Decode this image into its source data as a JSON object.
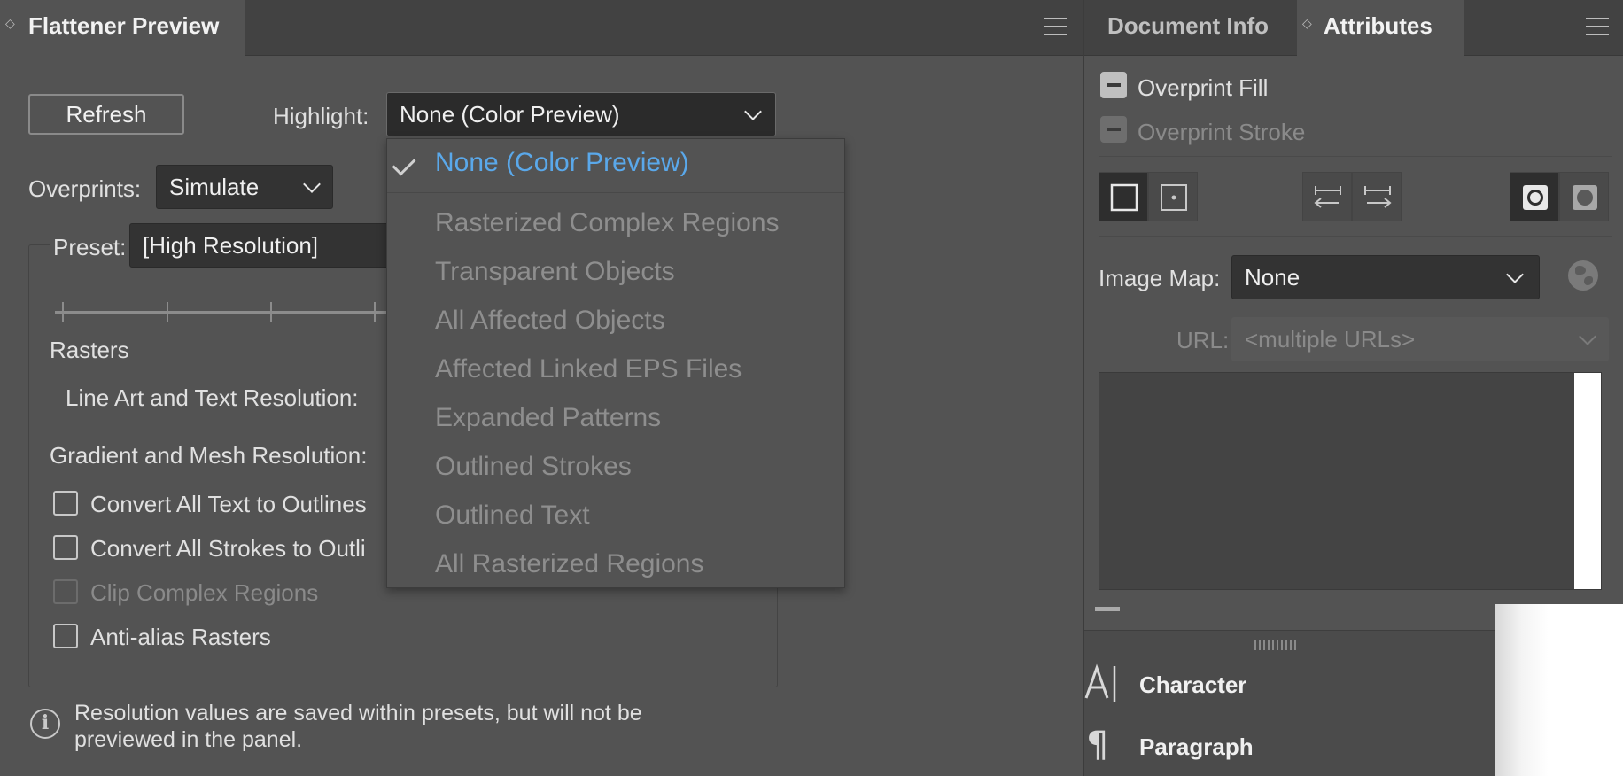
{
  "flattener": {
    "tab_title": "Flattener Preview",
    "refresh_label": "Refresh",
    "highlight_label": "Highlight:",
    "highlight_value": "None (Color Preview)",
    "overprints_label": "Overprints:",
    "overprints_value": "Simulate",
    "preset_label": "Preset:",
    "preset_value": "[High Resolution]",
    "rasters_label": "Rasters",
    "line_art_label": "Line Art and Text Resolution:",
    "gradient_label": "Gradient and Mesh Resolution:",
    "checkboxes": [
      {
        "label": "Convert All Text to Outlines",
        "checked": false,
        "enabled": true
      },
      {
        "label": "Convert All Strokes to Outli",
        "checked": false,
        "enabled": true
      },
      {
        "label": "Clip Complex Regions",
        "checked": false,
        "enabled": false
      },
      {
        "label": "Anti-alias Rasters",
        "checked": false,
        "enabled": true
      }
    ],
    "info_text": "Resolution values are saved within presets, but will not be previewed in the panel."
  },
  "highlight_dropdown": {
    "selected": "None (Color Preview)",
    "items": [
      "Rasterized Complex Regions",
      "Transparent Objects",
      "All Affected Objects",
      "Affected Linked EPS Files",
      "Expanded Patterns",
      "Outlined Strokes",
      "Outlined Text",
      "All Rasterized Regions"
    ]
  },
  "attributes": {
    "tab_document_info": "Document Info",
    "tab_attributes": "Attributes",
    "overprint_fill_label": "Overprint Fill",
    "overprint_stroke_label": "Overprint Stroke",
    "image_map_label": "Image Map:",
    "image_map_value": "None",
    "url_label": "URL:",
    "url_value": "<multiple URLs>"
  },
  "collapsed_panels": [
    {
      "label": "Character",
      "icon": "character-icon"
    },
    {
      "label": "Paragraph",
      "icon": "paragraph-icon"
    }
  ],
  "colors": {
    "panel_bg": "#535353",
    "tabbar_bg": "#424242",
    "selected_item": "#5aa8ea",
    "disabled_text": "#8e8e8e"
  }
}
